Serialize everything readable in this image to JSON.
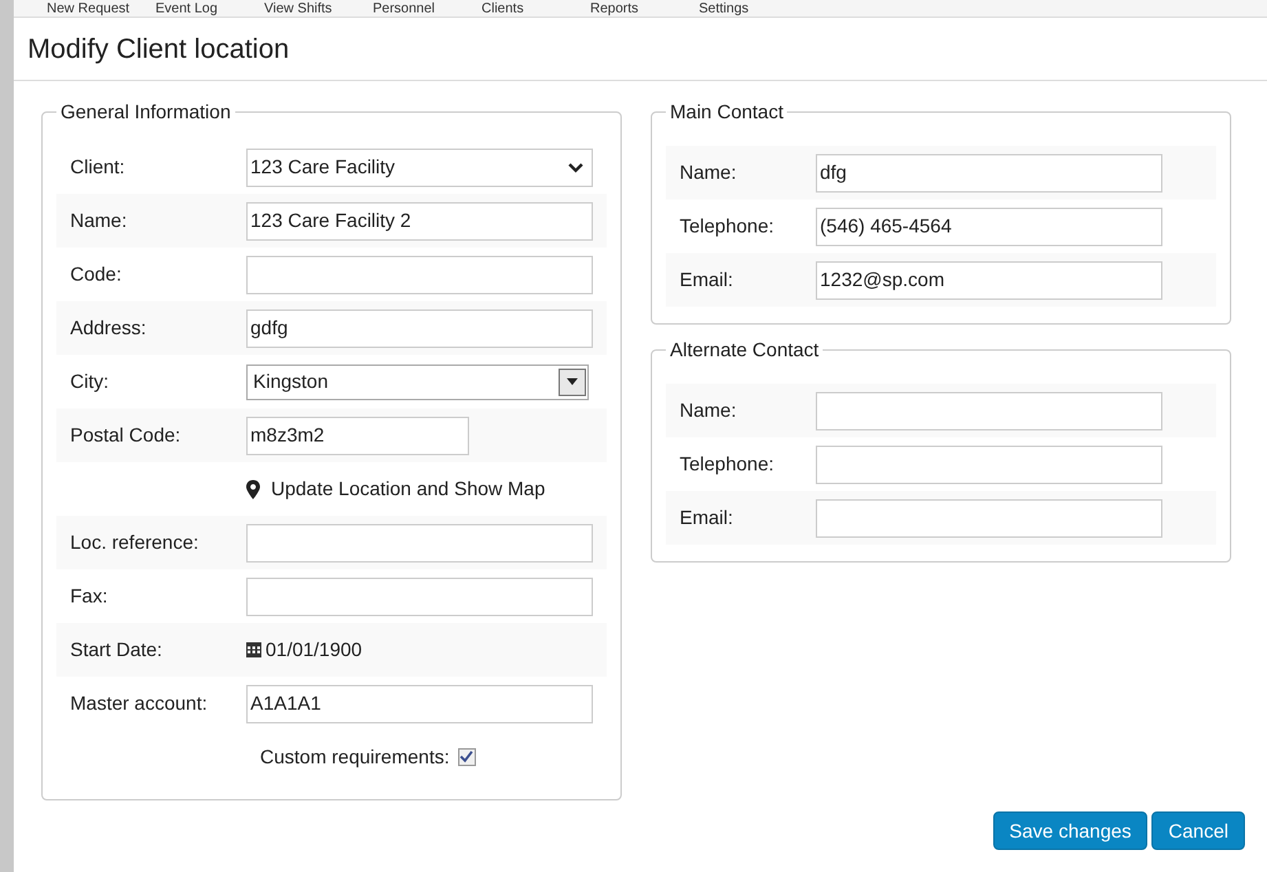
{
  "nav": [
    "New Request",
    "Event Log",
    "View Shifts",
    "Personnel",
    "Clients",
    "Reports",
    "Settings"
  ],
  "title": "Modify Client location",
  "general": {
    "legend": "General Information",
    "rows": [
      {
        "kind": "select",
        "label": "Client:",
        "value": "123 Care Facility"
      },
      {
        "kind": "text",
        "label": "Name:",
        "value": "123 Care Facility 2"
      },
      {
        "kind": "text",
        "label": "Code:"
      },
      {
        "kind": "text",
        "label": "Address:",
        "value": "gdfg"
      },
      {
        "kind": "combo",
        "label": "City:",
        "value": "Kingston"
      },
      {
        "kind": "short",
        "label": "Postal Code:",
        "value": "m8z3m2"
      },
      {
        "kind": "link",
        "value": "Update Location and Show Map"
      },
      {
        "kind": "text",
        "label": "Loc. reference:"
      },
      {
        "kind": "text",
        "label": "Fax:"
      },
      {
        "kind": "date",
        "label": "Start Date:",
        "value": "01/01/1900"
      },
      {
        "kind": "text",
        "label": "Master account:",
        "value": "A1A1A1"
      }
    ],
    "custom": {
      "label": "Custom requirements:",
      "checked": true
    }
  },
  "contacts": [
    {
      "legend": "Main Contact",
      "rows": [
        {
          "label": "Name:",
          "value": "dfg"
        },
        {
          "label": "Telephone:",
          "value": "(546) 465-4564"
        },
        {
          "label": "Email:",
          "value": "1232@sp.com"
        }
      ]
    },
    {
      "legend": "Alternate Contact",
      "rows": [
        {
          "label": "Name:"
        },
        {
          "label": "Telephone:"
        },
        {
          "label": "Email:"
        }
      ]
    }
  ],
  "buttons": [
    "Save changes",
    "Cancel"
  ]
}
